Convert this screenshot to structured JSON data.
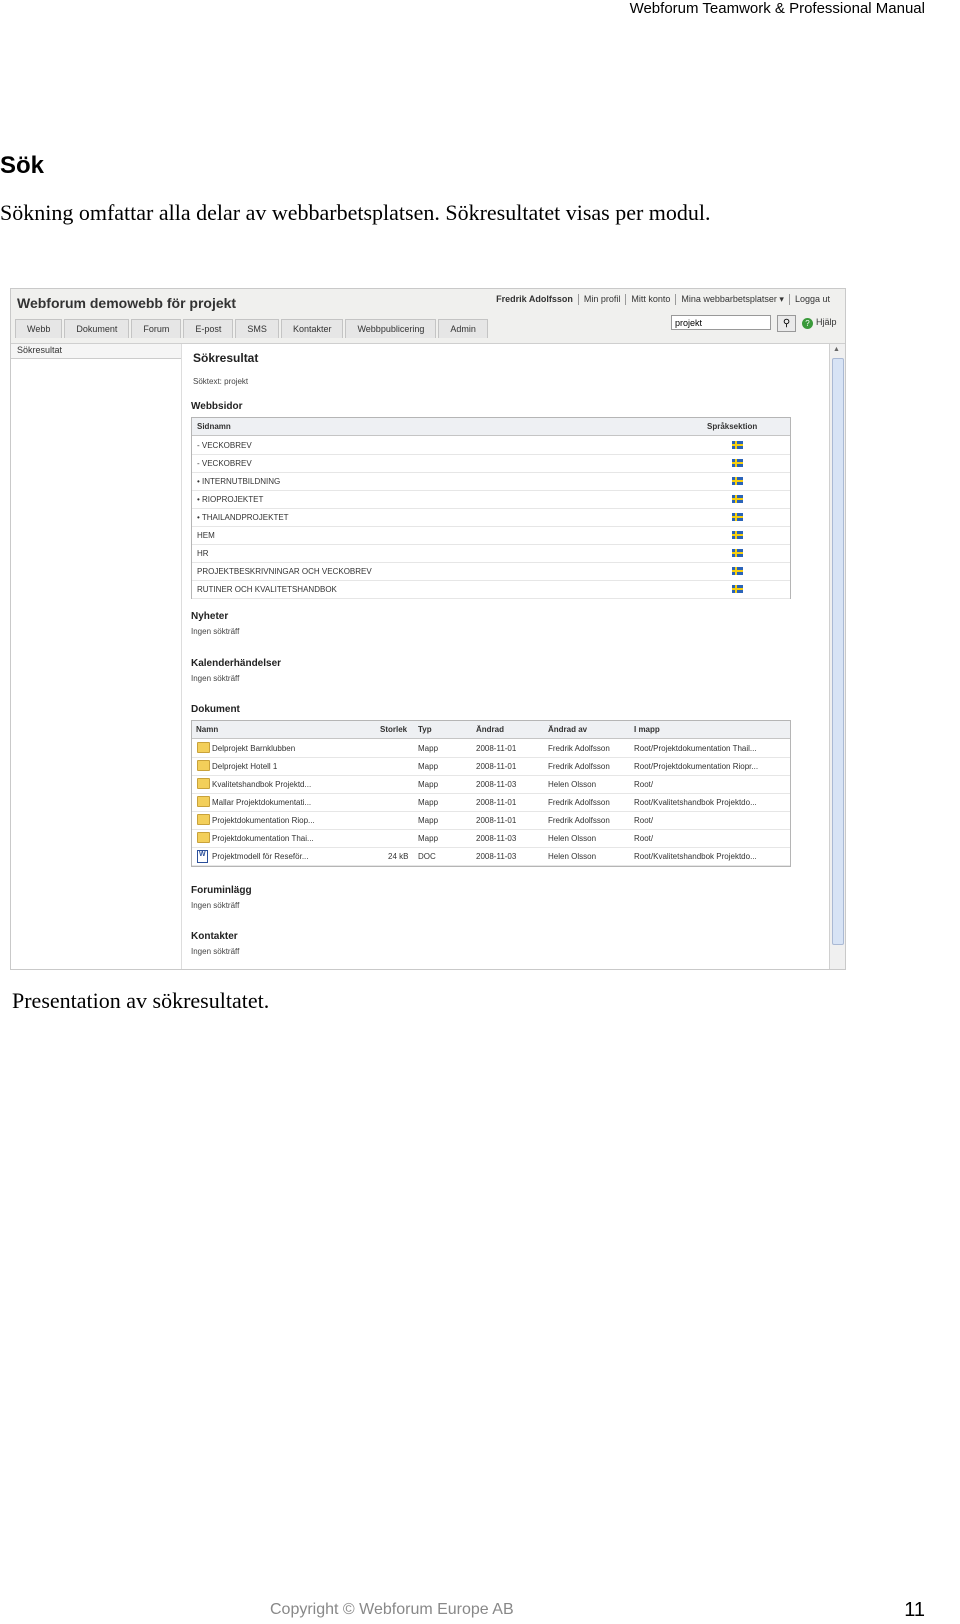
{
  "document": {
    "header": "Webforum Teamwork & Professional Manual",
    "heading": "Sök",
    "intro": "Sökning omfattar alla delar av webbarbetsplatsen. Sökresultatet visas per modul.",
    "caption": "Presentation av sökresultatet.",
    "footer": "Copyright © Webforum Europe AB",
    "page_number": "11"
  },
  "screenshot": {
    "app_title": "Webforum demowebb för projekt",
    "user_nav": [
      "Fredrik Adolfsson",
      "Min profil",
      "Mitt konto",
      "Mina webbarbetsplatser ▾",
      "Logga ut"
    ],
    "tabs": [
      "Webb",
      "Dokument",
      "Forum",
      "E-post",
      "SMS",
      "Kontakter",
      "Webbpublicering",
      "Admin"
    ],
    "search_value": "projekt",
    "help_label": "Hjälp",
    "left_nav_item": "Sökresultat",
    "results_title": "Sökresultat",
    "search_text": "Söktext: projekt",
    "webbsidor": {
      "title": "Webbsidor",
      "col_name": "Sidnamn",
      "col_lang": "Språksektion",
      "rows": [
        "- VECKOBREV",
        "- VECKOBREV",
        "• INTERNUTBILDNING",
        "• RIOPROJEKTET",
        "• THAILANDPROJEKTET",
        "HEM",
        "HR",
        "PROJEKTBESKRIVNINGAR OCH VECKOBREV",
        "RUTINER OCH KVALITETSHANDBOK"
      ]
    },
    "nyheter": {
      "title": "Nyheter",
      "note": "Ingen sökträff"
    },
    "kalender": {
      "title": "Kalenderhändelser",
      "note": "Ingen sökträff"
    },
    "dokument": {
      "title": "Dokument",
      "columns": [
        "Namn",
        "Storlek",
        "Typ",
        "Ändrad",
        "Ändrad av",
        "I mapp"
      ],
      "rows": [
        {
          "icon": "folder-icon",
          "name": "Delprojekt Barnklubben",
          "size": "",
          "type": "Mapp",
          "changed": "2008-11-01",
          "by": "Fredrik Adolfsson",
          "folder": "Root/Projektdokumentation Thail..."
        },
        {
          "icon": "folder-icon",
          "name": "Delprojekt Hotell 1",
          "size": "",
          "type": "Mapp",
          "changed": "2008-11-01",
          "by": "Fredrik Adolfsson",
          "folder": "Root/Projektdokumentation Riopr..."
        },
        {
          "icon": "folder-icon",
          "name": "Kvalitetshandbok Projektd...",
          "size": "",
          "type": "Mapp",
          "changed": "2008-11-03",
          "by": "Helen Olsson",
          "folder": "Root/"
        },
        {
          "icon": "folder-icon",
          "name": "Mallar Projektdokumentati...",
          "size": "",
          "type": "Mapp",
          "changed": "2008-11-01",
          "by": "Fredrik Adolfsson",
          "folder": "Root/Kvalitetshandbok Projektdo..."
        },
        {
          "icon": "folder-icon",
          "name": "Projektdokumentation Riop...",
          "size": "",
          "type": "Mapp",
          "changed": "2008-11-01",
          "by": "Fredrik Adolfsson",
          "folder": "Root/"
        },
        {
          "icon": "folder-icon",
          "name": "Projektdokumentation Thai...",
          "size": "",
          "type": "Mapp",
          "changed": "2008-11-03",
          "by": "Helen Olsson",
          "folder": "Root/"
        },
        {
          "icon": "word-doc-icon",
          "name": "Projektmodell för Reseför...",
          "size": "24 kB",
          "type": "DOC",
          "changed": "2008-11-03",
          "by": "Helen Olsson",
          "folder": "Root/Kvalitetshandbok Projektdo..."
        }
      ]
    },
    "forum": {
      "title": "Foruminlägg",
      "note": "Ingen sökträff"
    },
    "kontakter": {
      "title": "Kontakter",
      "note": "Ingen sökträff"
    }
  }
}
